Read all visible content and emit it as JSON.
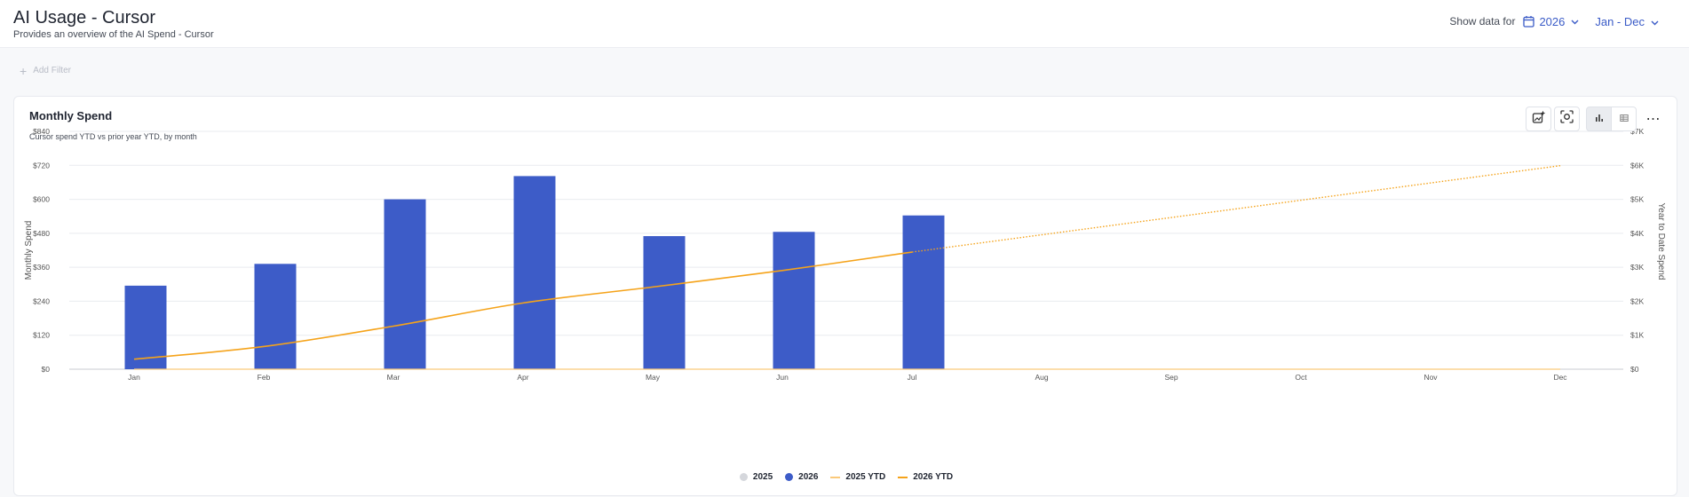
{
  "header": {
    "title": "AI Usage - Cursor",
    "subtitle": "Provides an overview of the AI Spend - Cursor",
    "show_label": "Show data for",
    "year": "2026",
    "range": "Jan - Dec"
  },
  "filter": {
    "label": "Add Filter"
  },
  "card": {
    "title": "Monthly Spend",
    "subtitle": "Cursor spend YTD vs prior year YTD, by month"
  },
  "icons": {
    "calendar": "calendar-icon",
    "chevron": "chevron-down-icon",
    "plus": "plus-icon",
    "ai": "ai-sparkle-icon",
    "camera": "screenshot-icon",
    "chart": "bar-chart-icon",
    "table": "table-icon",
    "more": "more-icon"
  },
  "colors": {
    "accent": "#3a5bc7",
    "bar2026": "#3d5cc8",
    "bar2025": "#d5d7dc",
    "line2026": "#f5a31a",
    "line2025": "#fbc97a"
  },
  "chart_data": {
    "type": "bar",
    "title": "Monthly Spend",
    "subtitle": "Cursor spend YTD vs prior year YTD, by month",
    "ylabel": "Monthly Spend",
    "y2label": "Year to Date Spend",
    "categories": [
      "Jan",
      "Feb",
      "Mar",
      "Apr",
      "May",
      "Jun",
      "Jul",
      "Aug",
      "Sep",
      "Oct",
      "Nov",
      "Dec"
    ],
    "ylim": [
      0,
      840
    ],
    "y2lim": [
      0,
      7000
    ],
    "yticks": [
      "$0",
      "$120",
      "$240",
      "$360",
      "$480",
      "$600",
      "$720",
      "$840"
    ],
    "y2ticks": [
      "$0",
      "$1K",
      "$2K",
      "$3K",
      "$4K",
      "$5K",
      "$6K",
      "$7K"
    ],
    "grid": true,
    "legend": "bottom-center",
    "series": [
      {
        "name": "2025",
        "kind": "bar",
        "values": [
          0,
          0,
          0,
          0,
          0,
          0,
          0,
          0,
          0,
          0,
          0,
          0
        ]
      },
      {
        "name": "2026",
        "kind": "bar",
        "values": [
          295,
          372,
          600,
          682,
          470,
          485,
          543,
          null,
          null,
          null,
          null,
          null
        ]
      },
      {
        "name": "2025 YTD",
        "kind": "line",
        "axis": "right",
        "values": [
          0,
          0,
          0,
          0,
          0,
          0,
          0,
          0,
          0,
          0,
          0,
          0
        ]
      },
      {
        "name": "2026 YTD",
        "kind": "line",
        "axis": "right",
        "values": [
          295,
          667,
          1267,
          1949,
          2419,
          2904,
          3447,
          null,
          null,
          null,
          null,
          null
        ]
      },
      {
        "name": "2026 YTD projection",
        "kind": "dotted-line",
        "axis": "right",
        "points": [
          [
            "Jul",
            3447
          ],
          [
            "Dec",
            5990
          ]
        ]
      }
    ]
  }
}
